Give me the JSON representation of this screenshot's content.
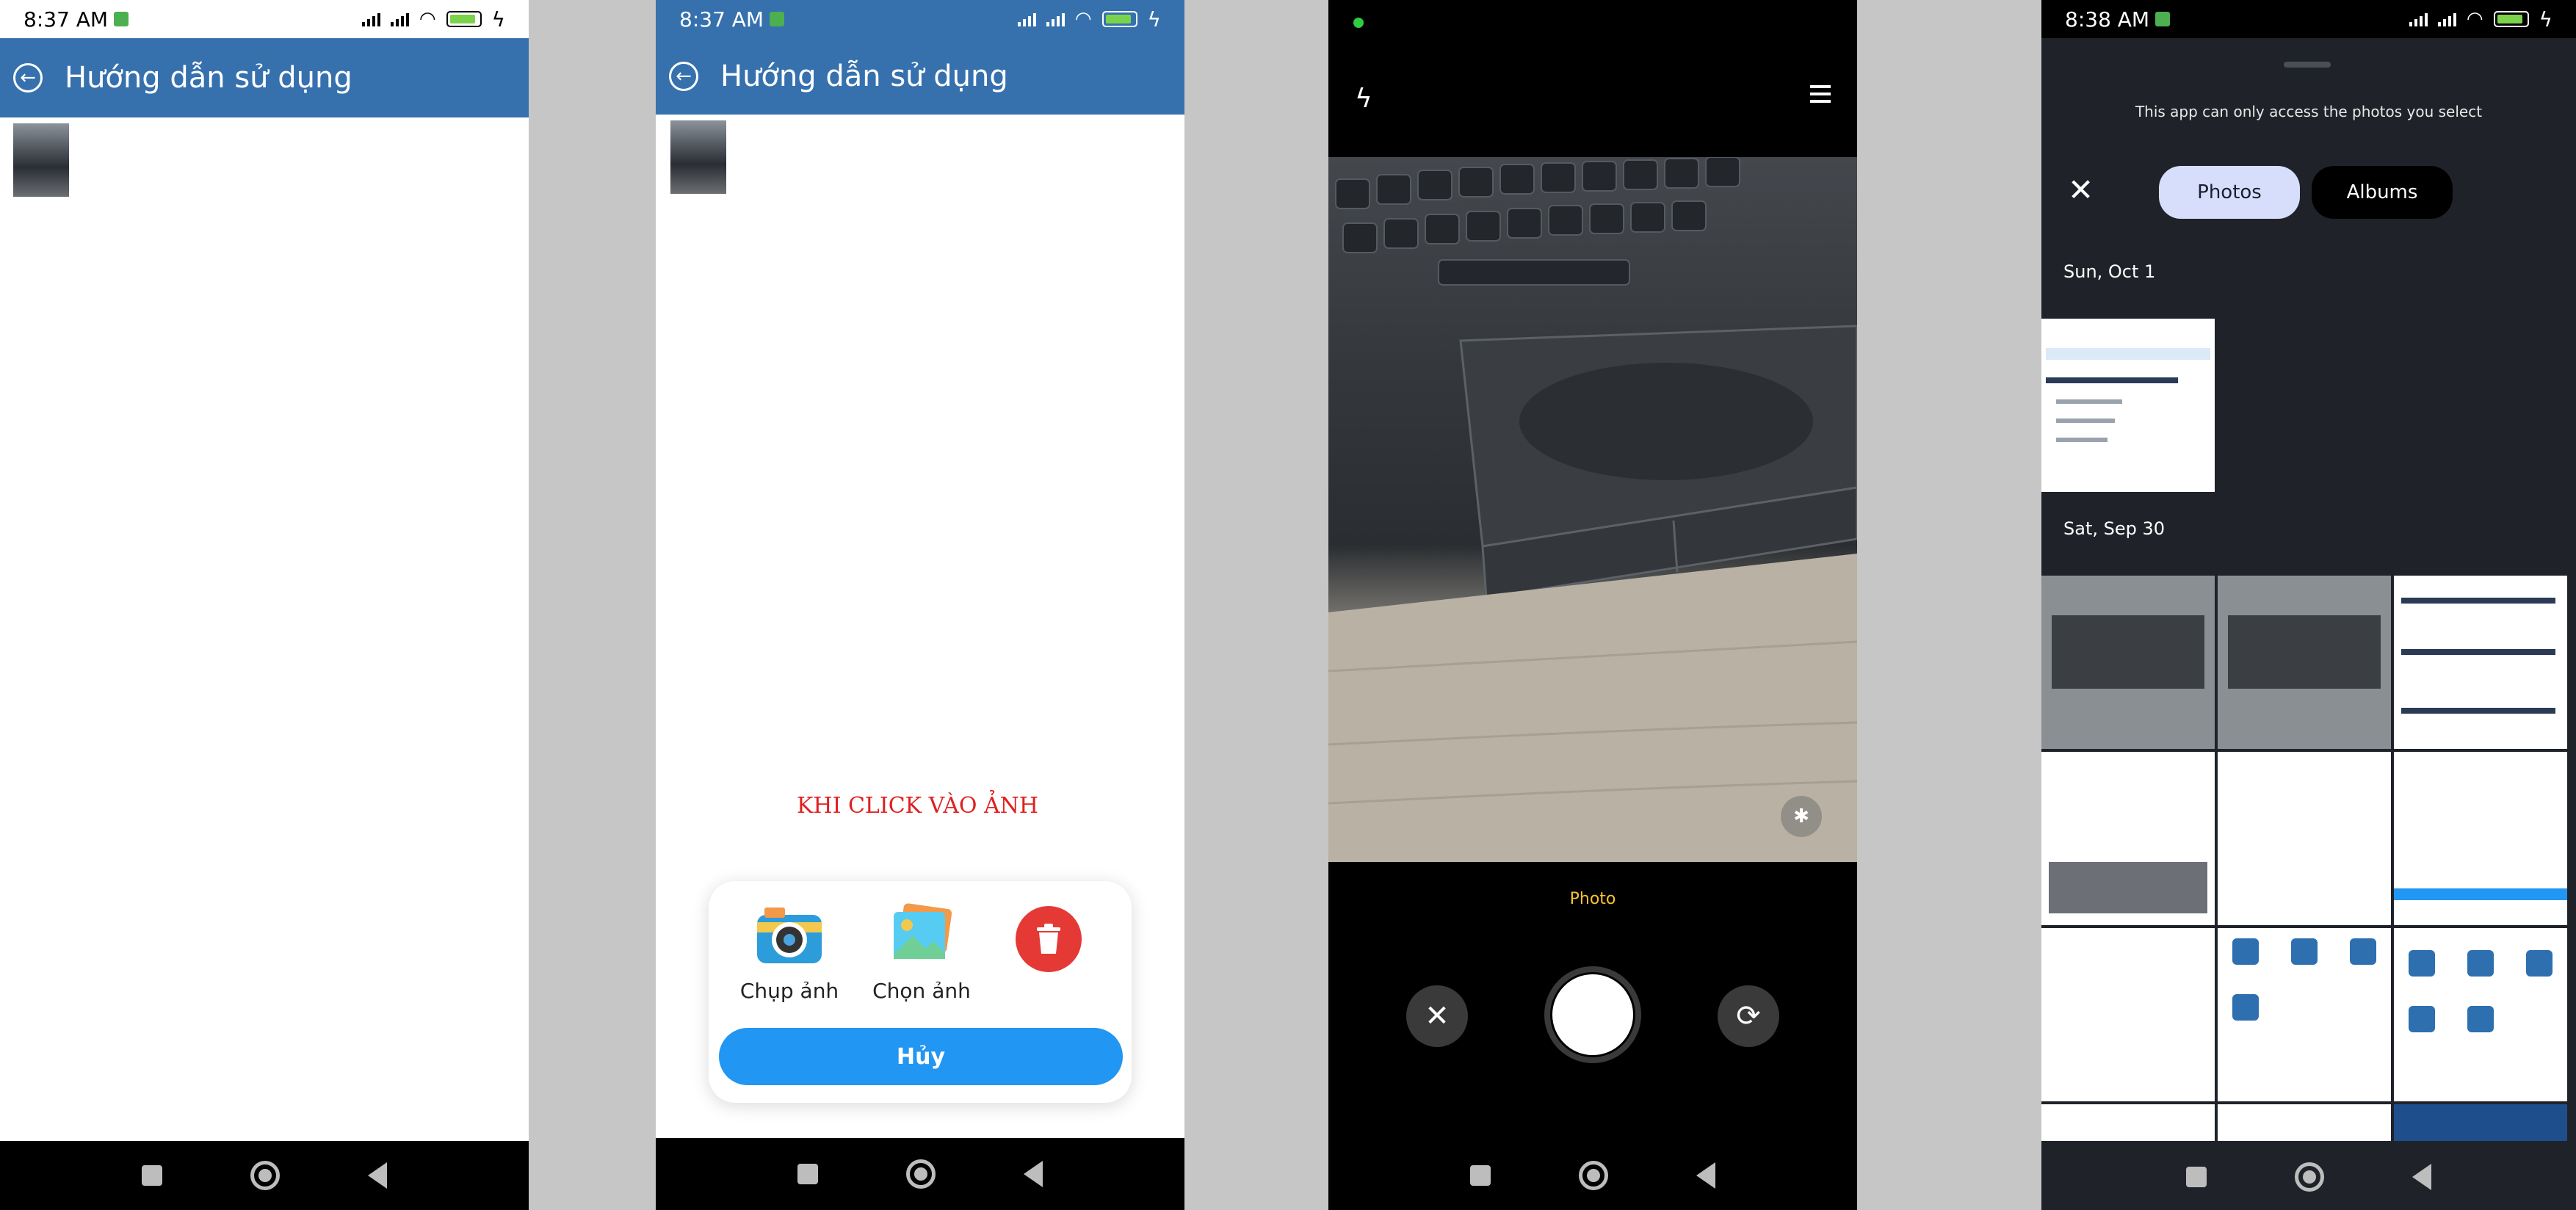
{
  "phones": [
    {
      "status": {
        "time": "8:37 AM"
      },
      "appbar": {
        "title": "Hướng dẫn sử dụng"
      }
    },
    {
      "status": {
        "time": "8:37 AM"
      },
      "appbar": {
        "title": "Hướng dẫn sử dụng"
      },
      "note": "KHI CLICK VÀO ẢNH",
      "sheet": {
        "options": [
          "Chụp ảnh",
          "Chọn ảnh"
        ],
        "cancel": "Hủy"
      }
    },
    {
      "camera": {
        "mode_label": "Photo"
      }
    },
    {
      "status": {
        "time": "8:38 AM"
      },
      "picker": {
        "notice": "This app can only access the photos you select",
        "tabs": [
          "Photos",
          "Albums"
        ],
        "sections": [
          "Sun, Oct 1",
          "Sat, Sep 30"
        ]
      }
    }
  ],
  "colors": {
    "appbar": "#3671ae",
    "accent_blue": "#2196f3",
    "delete_red": "#e53935",
    "photo_yellow": "#f7c331",
    "picker_bg": "#1f2329"
  }
}
